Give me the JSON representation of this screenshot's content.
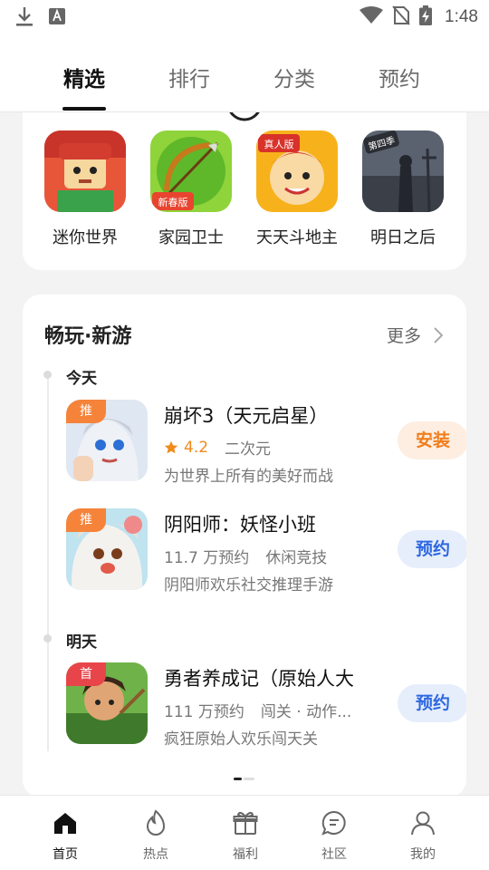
{
  "status_bar": {
    "time": "1:48",
    "left_icons": [
      "download-icon",
      "font-a-icon"
    ],
    "right_icons": [
      "wifi-icon",
      "no-sim-icon",
      "battery-charging-icon"
    ]
  },
  "tabs": [
    {
      "label": "精选",
      "active": true
    },
    {
      "label": "排行",
      "active": false
    },
    {
      "label": "分类",
      "active": false
    },
    {
      "label": "预约",
      "active": false
    }
  ],
  "top_apps": [
    {
      "name": "迷你世界"
    },
    {
      "name": "家园卫士",
      "corner_badge": "新春版"
    },
    {
      "name": "天天斗地主",
      "corner_badge": "真人版"
    },
    {
      "name": "明日之后",
      "corner_badge": "第四季"
    }
  ],
  "section": {
    "title": "畅玩·新游",
    "more_label": "更多",
    "days": [
      {
        "label": "今天",
        "games": [
          {
            "badge": "推",
            "name": "崩坏3（天元启星）",
            "rating": "4.2",
            "tag": "二次元",
            "desc": "为世界上所有的美好而战",
            "action": "安装"
          },
          {
            "badge": "推",
            "name": "阴阳师：妖怪小班",
            "reservations": "11.7 万预约",
            "tag": "休闲竞技",
            "desc": "阴阳师欢乐社交推理手游",
            "action": "预约"
          }
        ]
      },
      {
        "label": "明天",
        "games": [
          {
            "badge": "首",
            "name": "勇者养成记（原始人大",
            "reservations": "111 万预约",
            "tag": "闯关 · 动作...",
            "desc": "疯狂原始人欢乐闯天关",
            "action": "预约"
          }
        ]
      }
    ]
  },
  "bottom_nav": [
    {
      "label": "首页",
      "icon": "home-icon",
      "active": true
    },
    {
      "label": "热点",
      "icon": "flame-icon",
      "active": false
    },
    {
      "label": "福利",
      "icon": "gift-icon",
      "active": false
    },
    {
      "label": "社区",
      "icon": "chat-icon",
      "active": false
    },
    {
      "label": "我的",
      "icon": "user-icon",
      "active": false
    }
  ],
  "colors": {
    "install_text": "#f07d1c",
    "install_bg": "#fdeee1",
    "reserve_text": "#2f68e0",
    "reserve_bg": "#e6eefc",
    "badge_recommend": "#f5833a",
    "badge_first": "#e8454b"
  }
}
